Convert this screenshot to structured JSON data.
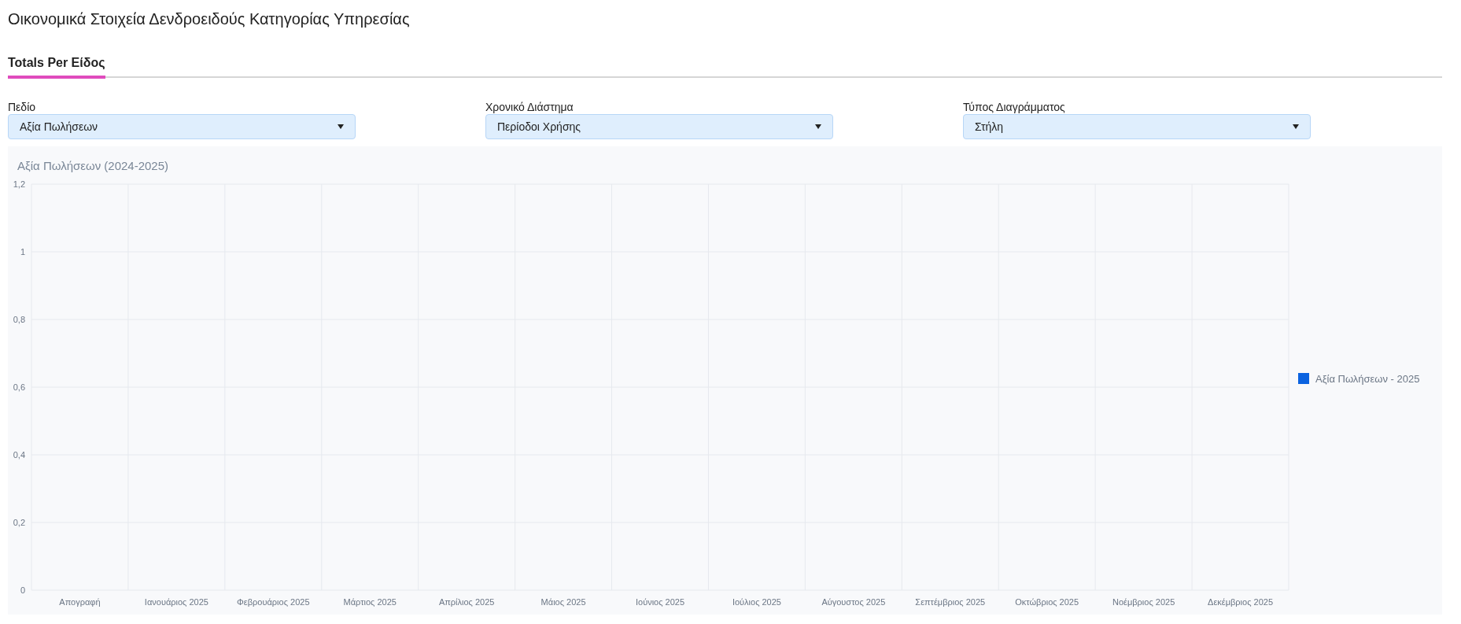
{
  "page": {
    "title": "Οικονομικά Στοιχεία Δενδροειδούς Κατηγορίας Υπηρεσίας"
  },
  "tabs": [
    {
      "label": "Totals Per Είδος",
      "selected": true
    }
  ],
  "filters": [
    {
      "label": "Πεδίο",
      "value": "Αξία Πωλήσεων"
    },
    {
      "label": "Χρονικό Διάστημα",
      "value": "Περίοδοι Χρήσης"
    },
    {
      "label": "Τύπος Διαγράμματος",
      "value": "Στήλη"
    }
  ],
  "chart_data": {
    "type": "bar",
    "title": "Αξία Πωλήσεων (2024-2025)",
    "categories": [
      "Απογραφή",
      "Ιανουάριος 2025",
      "Φεβρουάριος 2025",
      "Μάρτιος 2025",
      "Απρίλιος 2025",
      "Μάιος 2025",
      "Ιούνιος 2025",
      "Ιούλιος 2025",
      "Αύγουστος 2025",
      "Σεπτέμβριος 2025",
      "Οκτώβριος 2025",
      "Νοέμβριος 2025",
      "Δεκέμβριος 2025"
    ],
    "series": [
      {
        "name": "Αξία Πωλήσεων - 2025",
        "color": "#0b63e0",
        "values": [
          0,
          0,
          0,
          0,
          0,
          0,
          0,
          0,
          0,
          0,
          0,
          0,
          0
        ]
      }
    ],
    "ylim": [
      0,
      1.2
    ],
    "grid": true,
    "yticks": [
      {
        "value": 0,
        "label": "0"
      },
      {
        "value": 0.2,
        "label": "0,2"
      },
      {
        "value": 0.4,
        "label": "0,4"
      },
      {
        "value": 0.6,
        "label": "0,6"
      },
      {
        "value": 0.8,
        "label": "0,8"
      },
      {
        "value": 1,
        "label": "1"
      },
      {
        "value": 1.2,
        "label": "1,2"
      }
    ]
  }
}
